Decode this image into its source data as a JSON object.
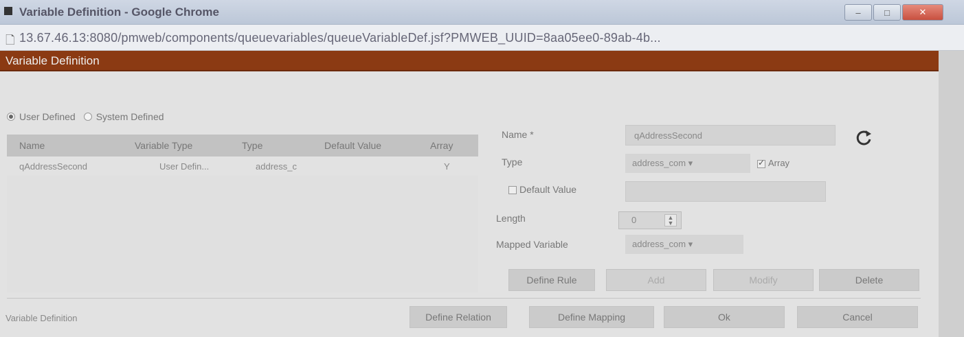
{
  "window": {
    "title": "Variable Definition - Google Chrome",
    "minimize": "–",
    "maximize": "□",
    "close": "✕"
  },
  "address_bar": {
    "url": "13.67.46.13:8080/pmweb/components/queuevariables/queueVariableDef.jsf?PMWEB_UUID=8aa05ee0-89ab-4b..."
  },
  "dialog": {
    "title": "Variable Definition"
  },
  "filter": {
    "user_defined": "User Defined",
    "system_defined": "System Defined",
    "selected": "User Defined"
  },
  "table": {
    "columns": [
      "Name",
      "Variable Type",
      "Type",
      "Default Value",
      "Array"
    ],
    "rows": [
      {
        "name": "qAddressSecond",
        "variable_type": "User Defin...",
        "type": "address_c",
        "default_value": "",
        "array": "Y"
      }
    ]
  },
  "form": {
    "name_label": "Name *",
    "name_value": "qAddressSecond",
    "type_label": "Type",
    "type_value": "address_com ▾",
    "array_label": "Array",
    "array_checked": true,
    "default_value_label": "Default Value",
    "default_value_checked": false,
    "default_value": "",
    "length_label": "Length",
    "length_value": "0",
    "mapped_variable_label": "Mapped Variable",
    "mapped_variable_value": "address_com ▾"
  },
  "actions": {
    "define_rule": "Define Rule",
    "add": "Add",
    "modify": "Modify",
    "delete": "Delete"
  },
  "footer": {
    "status": "Variable Definition",
    "define_relation": "Define Relation",
    "define_mapping": "Define Mapping",
    "ok": "Ok",
    "cancel": "Cancel"
  },
  "colors": {
    "dialog_title_bg": "#8b3a13",
    "body_bg": "#e2e2e2"
  }
}
